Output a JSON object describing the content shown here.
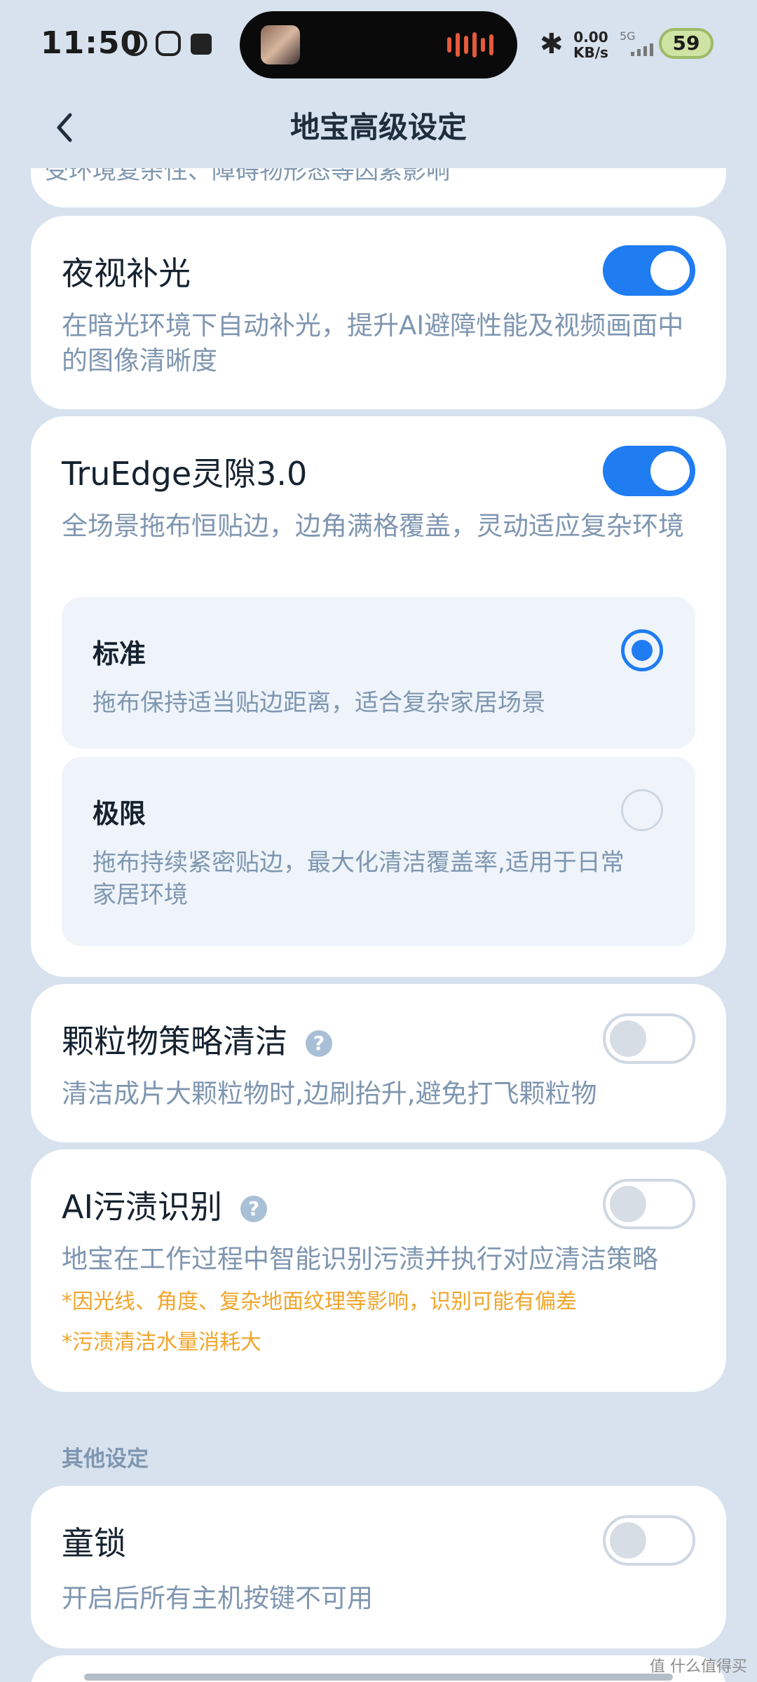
{
  "status_bar": {
    "time": "11:50",
    "bluetooth_icon": "bluetooth-icon",
    "speed_value": "0.00",
    "speed_unit": "KB/s",
    "network": "5G",
    "battery": "59"
  },
  "header": {
    "title": "地宝高级设定",
    "back_icon": "chevron-left-icon"
  },
  "clipped_card": {
    "text": "受环境复杂性、障碍物形态等因素影响"
  },
  "night_light": {
    "title": "夜视补光",
    "desc": "在暗光环境下自动补光，提升AI避障性能及视频画面中的图像清晰度",
    "enabled": true
  },
  "truedge": {
    "title": "TruEdge灵隙3.0",
    "desc": "全场景拖布恒贴边，边角满格覆盖，灵动适应复杂环境",
    "enabled": true,
    "options": [
      {
        "label": "标准",
        "desc": "拖布保持适当贴边距离，适合复杂家居场景",
        "selected": true
      },
      {
        "label": "极限",
        "desc": "拖布持续紧密贴边，最大化清洁覆盖率,适用于日常家居环境",
        "selected": false
      }
    ]
  },
  "particle": {
    "title": "颗粒物策略清洁",
    "desc": "清洁成片大颗粒物时,边刷抬升,避免打飞颗粒物",
    "enabled": false
  },
  "ai_stain": {
    "title": "AI污渍识别",
    "desc": "地宝在工作过程中智能识别污渍并执行对应清洁策略",
    "warning1": "*因光线、角度、复杂地面纹理等影响，识别可能有偏差",
    "warning2": "*污渍清洁水量消耗大",
    "enabled": false
  },
  "other_section": {
    "label": "其他设定"
  },
  "child_lock": {
    "title": "童锁",
    "desc": "开启后所有主机按键不可用",
    "enabled": false
  },
  "help_glyph": "?",
  "watermark": "值 什么值得买",
  "colors": {
    "accent": "#1f7cf1",
    "warning": "#f0a52b",
    "background": "#d7e2ee",
    "secondary_text": "#7f96b0"
  }
}
